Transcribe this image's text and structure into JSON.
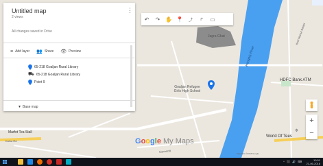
{
  "map": {
    "title": "Untitled map",
    "views": "2 views",
    "saved_status": "All changes saved in Drive",
    "actions": {
      "add_layer": "Add layer",
      "share": "Share",
      "preview": "Preview"
    },
    "layer_items": [
      {
        "label": "65-218 Goaljan Rural Library",
        "icon": "pin-icon"
      },
      {
        "label": "65-218 Goaljan Rural Library",
        "icon": "route-icon"
      },
      {
        "label": "Point 9",
        "icon": "pin-icon"
      }
    ],
    "base_map_label": "Base map"
  },
  "labels": {
    "school": "Goaljan Refugee\nGirls High School",
    "river": "Hooghly River",
    "market": "Jagra Ghat",
    "bank": "HDFC Bank ATM",
    "road_top_right": "Kazi Nazrul Sarani",
    "shop": "Marfot Tea Stall",
    "world": "World Of Tees",
    "road_small": "Kalna Rd",
    "road_bottom": "Connectit"
  },
  "branding": {
    "logo_google": "Google",
    "logo_mymaps": "My Maps"
  },
  "attribution": "Map data ©2018 Google",
  "taskbar": {
    "tray_text": "^ ⬛ 🔊 ⌨",
    "time": "10:51",
    "date": "21-06-2018"
  },
  "colors": {
    "river": "#4aa0f0",
    "pin": "#1a73e8",
    "accent_green": "#34a853"
  }
}
